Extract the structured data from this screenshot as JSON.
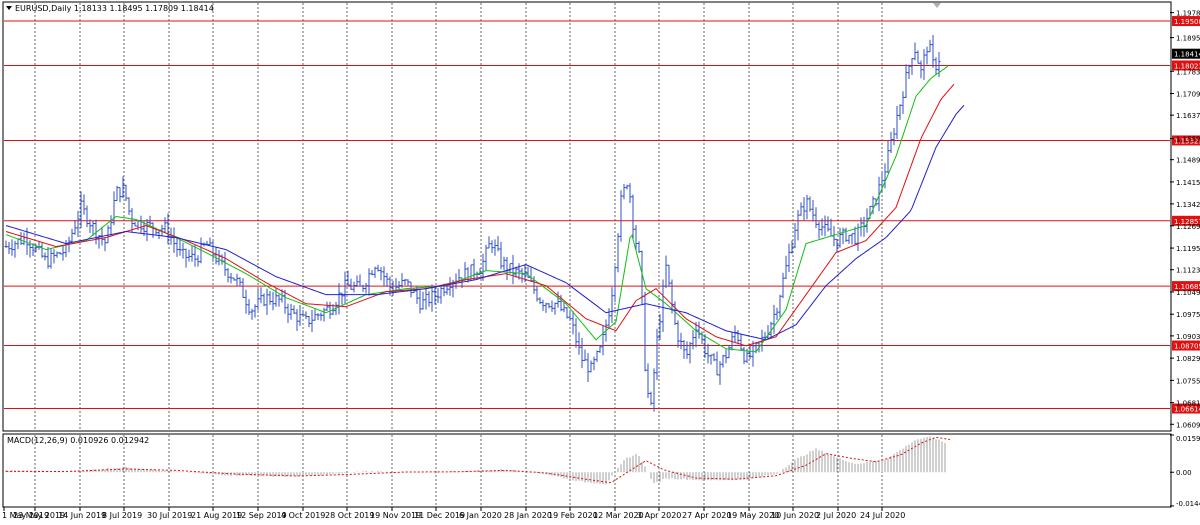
{
  "header": {
    "symbol_info": "EURUSD,Daily  1.18133 1.18495 1.17809 1.18414",
    "indicator_label": "MACD(12,26,9) 0.010926 0.012942"
  },
  "colors": {
    "background": "#ffffff",
    "grid": "#000000",
    "candle": "#3050c8",
    "level": "#e01010",
    "ma_fast": "#10c010",
    "ma_mid": "#e01010",
    "ma_slow": "#2020d0",
    "macd_hist": "#a0a0a0",
    "macd_signal": "#e01010",
    "current_price_bg": "#000000"
  },
  "price_axis": {
    "ticks": [
      "1.19780",
      "1.18950",
      "1.17830",
      "1.17090",
      "1.16370",
      "1.15590",
      "1.14890",
      "1.14150",
      "1.13420",
      "1.12690",
      "1.11950",
      "1.11230",
      "1.10490",
      "1.09750",
      "1.09030",
      "1.08290",
      "1.07550",
      "1.06810",
      "1.06090"
    ],
    "current_price": "1.18414"
  },
  "macd_axis": {
    "ticks": [
      "0.015993",
      "0.00",
      "-0.014466"
    ]
  },
  "chart_data": {
    "type": "candlestick",
    "ylim": [
      1.059,
      1.201
    ],
    "x_tick_labels": [
      "1 May 2019",
      "23 May 2019",
      "14 Jun 2019",
      "8 Jul 2019",
      "30 Jul 2019",
      "21 Aug 2019",
      "12 Sep 2019",
      "4 Oct 2019",
      "28 Oct 2019",
      "19 Nov 2019",
      "11 Dec 2019",
      "6 Jan 2020",
      "28 Jan 2020",
      "19 Feb 2020",
      "12 Mar 2020",
      "3 Apr 2020",
      "27 Apr 2020",
      "19 May 2020",
      "10 Jun 2020",
      "2 Jul 2020",
      "24 Jul 2020"
    ],
    "horizontal_levels": [
      {
        "value": 1.195,
        "label": "1.19500"
      },
      {
        "value": 1.18023,
        "label": "1.18023"
      },
      {
        "value": 1.15529,
        "label": "1.15529"
      },
      {
        "value": 1.12857,
        "label": "1.12857"
      },
      {
        "value": 1.10685,
        "label": "1.10685"
      },
      {
        "value": 1.08709,
        "label": "1.08709"
      },
      {
        "value": 1.06614,
        "label": "1.06614"
      }
    ],
    "close_path": [
      [
        0,
        1.12
      ],
      [
        20,
        1.123
      ],
      [
        40,
        1.115
      ],
      [
        60,
        1.119
      ],
      [
        75,
        1.133
      ],
      [
        90,
        1.125
      ],
      [
        100,
        1.121
      ],
      [
        110,
        1.138
      ],
      [
        118,
        1.139
      ],
      [
        125,
        1.129
      ],
      [
        140,
        1.127
      ],
      [
        160,
        1.126
      ],
      [
        175,
        1.117
      ],
      [
        190,
        1.116
      ],
      [
        200,
        1.121
      ],
      [
        215,
        1.114
      ],
      [
        230,
        1.109
      ],
      [
        245,
        1.099
      ],
      [
        260,
        1.103
      ],
      [
        275,
        1.102
      ],
      [
        285,
        1.098
      ],
      [
        300,
        1.095
      ],
      [
        310,
        1.097
      ],
      [
        325,
        1.1
      ],
      [
        340,
        1.107
      ],
      [
        355,
        1.106
      ],
      [
        370,
        1.115
      ],
      [
        385,
        1.106
      ],
      [
        400,
        1.108
      ],
      [
        415,
        1.101
      ],
      [
        430,
        1.104
      ],
      [
        445,
        1.109
      ],
      [
        460,
        1.111
      ],
      [
        475,
        1.113
      ],
      [
        485,
        1.122
      ],
      [
        495,
        1.115
      ],
      [
        505,
        1.112
      ],
      [
        520,
        1.11
      ],
      [
        535,
        1.102
      ],
      [
        550,
        1.101
      ],
      [
        565,
        1.095
      ],
      [
        575,
        1.083
      ],
      [
        585,
        1.079
      ],
      [
        595,
        1.086
      ],
      [
        605,
        1.102
      ],
      [
        615,
        1.135
      ],
      [
        622,
        1.143
      ],
      [
        628,
        1.125
      ],
      [
        634,
        1.115
      ],
      [
        640,
        1.074
      ],
      [
        645,
        1.066
      ],
      [
        650,
        1.086
      ],
      [
        660,
        1.113
      ],
      [
        670,
        1.092
      ],
      [
        680,
        1.083
      ],
      [
        690,
        1.094
      ],
      [
        700,
        1.085
      ],
      [
        710,
        1.079
      ],
      [
        720,
        1.084
      ],
      [
        730,
        1.092
      ],
      [
        740,
        1.082
      ],
      [
        750,
        1.086
      ],
      [
        760,
        1.091
      ],
      [
        770,
        1.099
      ],
      [
        780,
        1.113
      ],
      [
        790,
        1.128
      ],
      [
        800,
        1.135
      ],
      [
        810,
        1.129
      ],
      [
        820,
        1.125
      ],
      [
        830,
        1.122
      ],
      [
        840,
        1.124
      ],
      [
        850,
        1.123
      ],
      [
        860,
        1.129
      ],
      [
        870,
        1.136
      ],
      [
        880,
        1.147
      ],
      [
        890,
        1.162
      ],
      [
        900,
        1.176
      ],
      [
        908,
        1.187
      ],
      [
        915,
        1.178
      ],
      [
        922,
        1.188
      ],
      [
        928,
        1.179
      ],
      [
        935,
        1.1841
      ]
    ],
    "moving_averages": [
      {
        "color_key": "ma_fast",
        "path": [
          [
            0,
            1.124
          ],
          [
            40,
            1.119
          ],
          [
            80,
            1.122
          ],
          [
            110,
            1.13
          ],
          [
            130,
            1.129
          ],
          [
            170,
            1.123
          ],
          [
            200,
            1.118
          ],
          [
            240,
            1.111
          ],
          [
            280,
            1.103
          ],
          [
            320,
            1.098
          ],
          [
            360,
            1.104
          ],
          [
            400,
            1.106
          ],
          [
            440,
            1.107
          ],
          [
            480,
            1.112
          ],
          [
            520,
            1.111
          ],
          [
            560,
            1.101
          ],
          [
            590,
            1.089
          ],
          [
            610,
            1.095
          ],
          [
            625,
            1.125
          ],
          [
            640,
            1.106
          ],
          [
            660,
            1.101
          ],
          [
            690,
            1.092
          ],
          [
            720,
            1.086
          ],
          [
            750,
            1.085
          ],
          [
            780,
            1.099
          ],
          [
            800,
            1.121
          ],
          [
            830,
            1.124
          ],
          [
            860,
            1.127
          ],
          [
            890,
            1.15
          ],
          [
            910,
            1.17
          ],
          [
            925,
            1.176
          ],
          [
            942,
            1.18
          ]
        ]
      },
      {
        "color_key": "ma_mid",
        "path": [
          [
            0,
            1.125
          ],
          [
            50,
            1.12
          ],
          [
            100,
            1.123
          ],
          [
            140,
            1.127
          ],
          [
            180,
            1.122
          ],
          [
            220,
            1.116
          ],
          [
            260,
            1.108
          ],
          [
            300,
            1.101
          ],
          [
            340,
            1.1
          ],
          [
            380,
            1.105
          ],
          [
            420,
            1.106
          ],
          [
            460,
            1.109
          ],
          [
            500,
            1.111
          ],
          [
            540,
            1.107
          ],
          [
            580,
            1.096
          ],
          [
            610,
            1.092
          ],
          [
            630,
            1.102
          ],
          [
            650,
            1.106
          ],
          [
            680,
            1.096
          ],
          [
            710,
            1.09
          ],
          [
            740,
            1.087
          ],
          [
            770,
            1.09
          ],
          [
            800,
            1.104
          ],
          [
            830,
            1.118
          ],
          [
            860,
            1.122
          ],
          [
            890,
            1.133
          ],
          [
            915,
            1.156
          ],
          [
            935,
            1.169
          ],
          [
            948,
            1.174
          ]
        ]
      },
      {
        "color_key": "ma_slow",
        "path": [
          [
            0,
            1.127
          ],
          [
            60,
            1.121
          ],
          [
            120,
            1.125
          ],
          [
            170,
            1.123
          ],
          [
            220,
            1.119
          ],
          [
            270,
            1.11
          ],
          [
            320,
            1.104
          ],
          [
            370,
            1.104
          ],
          [
            420,
            1.106
          ],
          [
            470,
            1.109
          ],
          [
            520,
            1.114
          ],
          [
            560,
            1.108
          ],
          [
            600,
            1.098
          ],
          [
            640,
            1.101
          ],
          [
            680,
            1.098
          ],
          [
            720,
            1.092
          ],
          [
            760,
            1.089
          ],
          [
            790,
            1.094
          ],
          [
            820,
            1.107
          ],
          [
            850,
            1.116
          ],
          [
            880,
            1.123
          ],
          [
            905,
            1.132
          ],
          [
            930,
            1.153
          ],
          [
            950,
            1.164
          ],
          [
            958,
            1.167
          ]
        ]
      }
    ],
    "macd": {
      "ylim": [
        -0.0145,
        0.016
      ],
      "histogram_path": [
        [
          0,
          0.0008
        ],
        [
          60,
          0.0002
        ],
        [
          120,
          0.0022
        ],
        [
          160,
          0.0005
        ],
        [
          220,
          -0.0012
        ],
        [
          280,
          -0.0018
        ],
        [
          320,
          -0.001
        ],
        [
          360,
          0.0004
        ],
        [
          420,
          -0.0002
        ],
        [
          470,
          0.0006
        ],
        [
          500,
          0.0012
        ],
        [
          540,
          -0.0008
        ],
        [
          575,
          -0.004
        ],
        [
          600,
          -0.005
        ],
        [
          620,
          0.006
        ],
        [
          632,
          0.008
        ],
        [
          648,
          -0.005
        ],
        [
          660,
          -0.0025
        ],
        [
          700,
          -0.0035
        ],
        [
          740,
          -0.003
        ],
        [
          770,
          -0.0008
        ],
        [
          790,
          0.0055
        ],
        [
          810,
          0.01
        ],
        [
          830,
          0.0065
        ],
        [
          850,
          0.0035
        ],
        [
          880,
          0.0055
        ],
        [
          910,
          0.014
        ],
        [
          925,
          0.0152
        ],
        [
          940,
          0.0125
        ]
      ],
      "signal_path": [
        [
          0,
          0.0004
        ],
        [
          60,
          0.0003
        ],
        [
          120,
          0.0014
        ],
        [
          170,
          0.0008
        ],
        [
          230,
          -0.0008
        ],
        [
          290,
          -0.0016
        ],
        [
          340,
          -0.001
        ],
        [
          400,
          0.0001
        ],
        [
          450,
          0.0002
        ],
        [
          500,
          0.0008
        ],
        [
          540,
          -0.0003
        ],
        [
          580,
          -0.003
        ],
        [
          605,
          -0.0045
        ],
        [
          625,
          0.001
        ],
        [
          640,
          0.005
        ],
        [
          658,
          0.001
        ],
        [
          690,
          -0.0025
        ],
        [
          730,
          -0.003
        ],
        [
          770,
          -0.0015
        ],
        [
          800,
          0.003
        ],
        [
          820,
          0.008
        ],
        [
          845,
          0.006
        ],
        [
          870,
          0.0045
        ],
        [
          895,
          0.0075
        ],
        [
          915,
          0.0125
        ],
        [
          930,
          0.015
        ],
        [
          945,
          0.014
        ]
      ]
    }
  }
}
